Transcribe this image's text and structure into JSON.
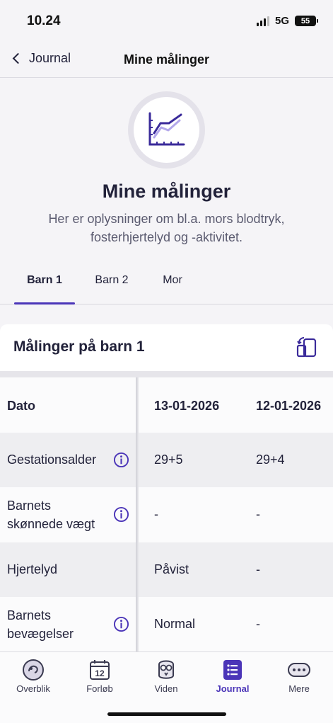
{
  "status_bar": {
    "time": "10.24",
    "network": "5G",
    "battery": "55"
  },
  "nav": {
    "back_label": "Journal",
    "title": "Mine målinger"
  },
  "hero": {
    "icon": "line-chart-icon",
    "title": "Mine målinger",
    "subtitle": "Her er oplysninger om bl.a. mors blodtryk, fosterhjertelyd og -aktivitet."
  },
  "tabs": [
    {
      "label": "Barn 1",
      "active": true
    },
    {
      "label": "Barn 2",
      "active": false
    },
    {
      "label": "Mor",
      "active": false
    }
  ],
  "card": {
    "title": "Målinger på barn 1",
    "action_icon": "rotate-device-icon"
  },
  "table": {
    "header": {
      "label": "Dato",
      "dates": [
        "13-01-2026",
        "12-01-2026"
      ]
    },
    "rows": [
      {
        "label": "Gestationsalder",
        "info": true,
        "values": [
          "29+5",
          "29+4"
        ]
      },
      {
        "label": "Barnets skønnede vægt",
        "info": true,
        "values": [
          "-",
          "-"
        ]
      },
      {
        "label": "Hjertelyd",
        "info": false,
        "values": [
          "Påvist",
          "-"
        ]
      },
      {
        "label": "Barnets bevægelser",
        "info": true,
        "values": [
          "Normal",
          "-"
        ]
      }
    ]
  },
  "tabbar": [
    {
      "label": "Overblik",
      "icon": "baby-belly-icon",
      "active": false
    },
    {
      "label": "Forløb",
      "icon": "calendar-icon",
      "calendar_day": "12",
      "active": false
    },
    {
      "label": "Viden",
      "icon": "owl-icon",
      "active": false
    },
    {
      "label": "Journal",
      "icon": "journal-list-icon",
      "active": true
    },
    {
      "label": "Mere",
      "icon": "more-icon",
      "active": false
    }
  ],
  "colors": {
    "accent": "#4b35b8",
    "text": "#22223a",
    "background": "#f5f4f7"
  }
}
